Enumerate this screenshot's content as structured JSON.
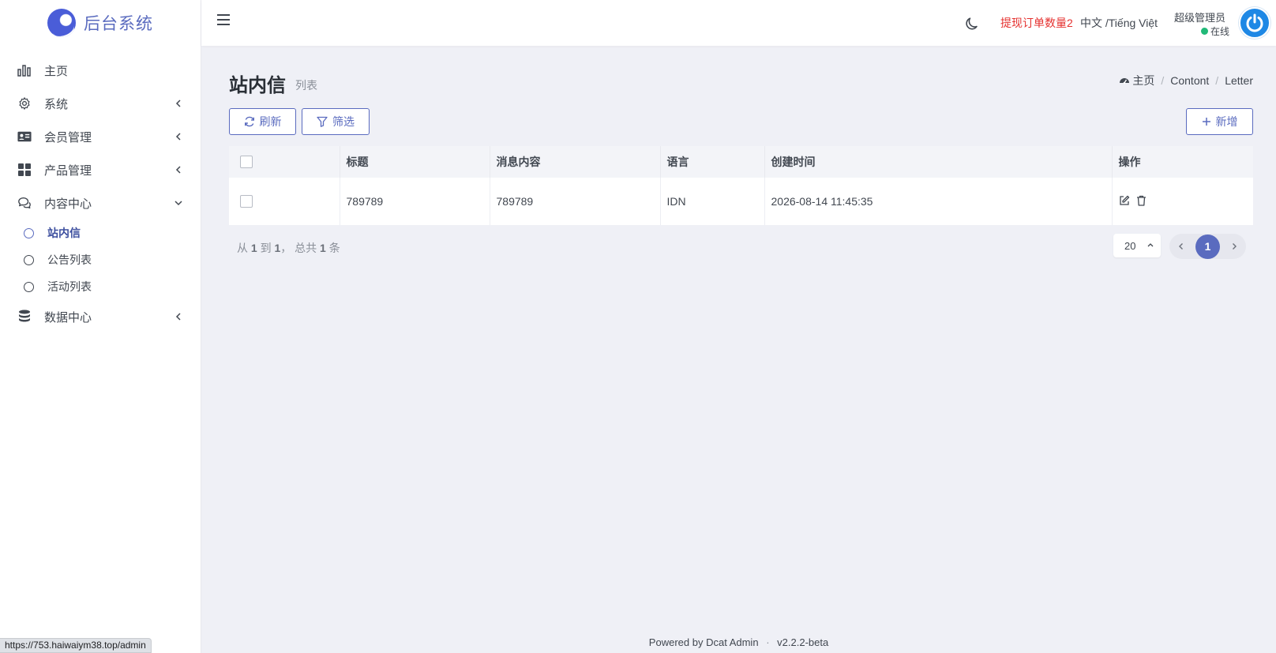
{
  "brand": {
    "title": "后台系统"
  },
  "sidebar": {
    "items": [
      {
        "label": "主页",
        "icon": "bar-chart-icon"
      },
      {
        "label": "系统",
        "icon": "gear-icon"
      },
      {
        "label": "会员管理",
        "icon": "id-card-icon"
      },
      {
        "label": "产品管理",
        "icon": "grid-icon"
      },
      {
        "label": "内容中心",
        "icon": "chat-icon"
      },
      {
        "label": "数据中心",
        "icon": "database-icon"
      }
    ],
    "subitems": [
      {
        "label": "站内信",
        "active": true
      },
      {
        "label": "公告列表",
        "active": false
      },
      {
        "label": "活动列表",
        "active": false
      }
    ]
  },
  "header": {
    "withdraw": "提现订单数量2",
    "lang": "中文 /Tiếng Việt",
    "user_name": "超级管理员",
    "user_status": "在线"
  },
  "page": {
    "title": "站内信",
    "subtitle": "列表",
    "breadcrumb": [
      "主页",
      "Contont",
      "Letter"
    ]
  },
  "toolbar": {
    "refresh": "刷新",
    "filter": "筛选",
    "new": "新增"
  },
  "table": {
    "columns": [
      "标题",
      "消息内容",
      "语言",
      "创建时间",
      "操作"
    ],
    "rows": [
      {
        "title": "789789",
        "content": "789789",
        "lang": "IDN",
        "created": "2026-08-14 11:45:35"
      }
    ]
  },
  "pagination": {
    "summary_pre": "从",
    "from": "1",
    "summary_to": "到",
    "to": "1",
    "summary_total": "， 总共",
    "total": "1",
    "summary_unit": "条",
    "per_page": "20",
    "current": "1"
  },
  "footer": {
    "powered_prefix": "Powered by",
    "powered_name": "Dcat Admin",
    "version": "v2.2.2-beta"
  },
  "status_bar": {
    "url": "https://753.haiwaiym38.top/admin"
  },
  "colors": {
    "accent": "#5a6bbf",
    "alert": "#e5312f",
    "online": "#21b978"
  }
}
